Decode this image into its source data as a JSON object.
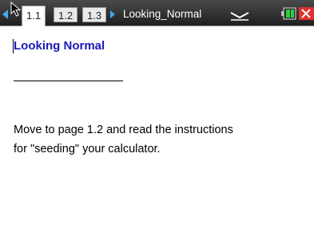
{
  "toolbar": {
    "tabs": [
      {
        "label": "1.1",
        "active": true
      },
      {
        "label": "1.2",
        "active": false
      },
      {
        "label": "1.3",
        "active": false
      }
    ],
    "document_name": "Looking_Normal",
    "icons": [
      "nav-left-icon",
      "pointer-cursor-icon",
      "nav-right-icon",
      "dropdown-chevron-icon",
      "battery-icon",
      "close-icon"
    ]
  },
  "document": {
    "heading": "Looking Normal",
    "paragraph_line1": "Move to page 1.2 and read the instructions",
    "paragraph_line2": "for \"seeding\" your calculator."
  },
  "colors": {
    "accent": "#3fa9f5",
    "heading": "#1a1ab8",
    "close": "#e03030",
    "battery": "#2ecc40"
  }
}
